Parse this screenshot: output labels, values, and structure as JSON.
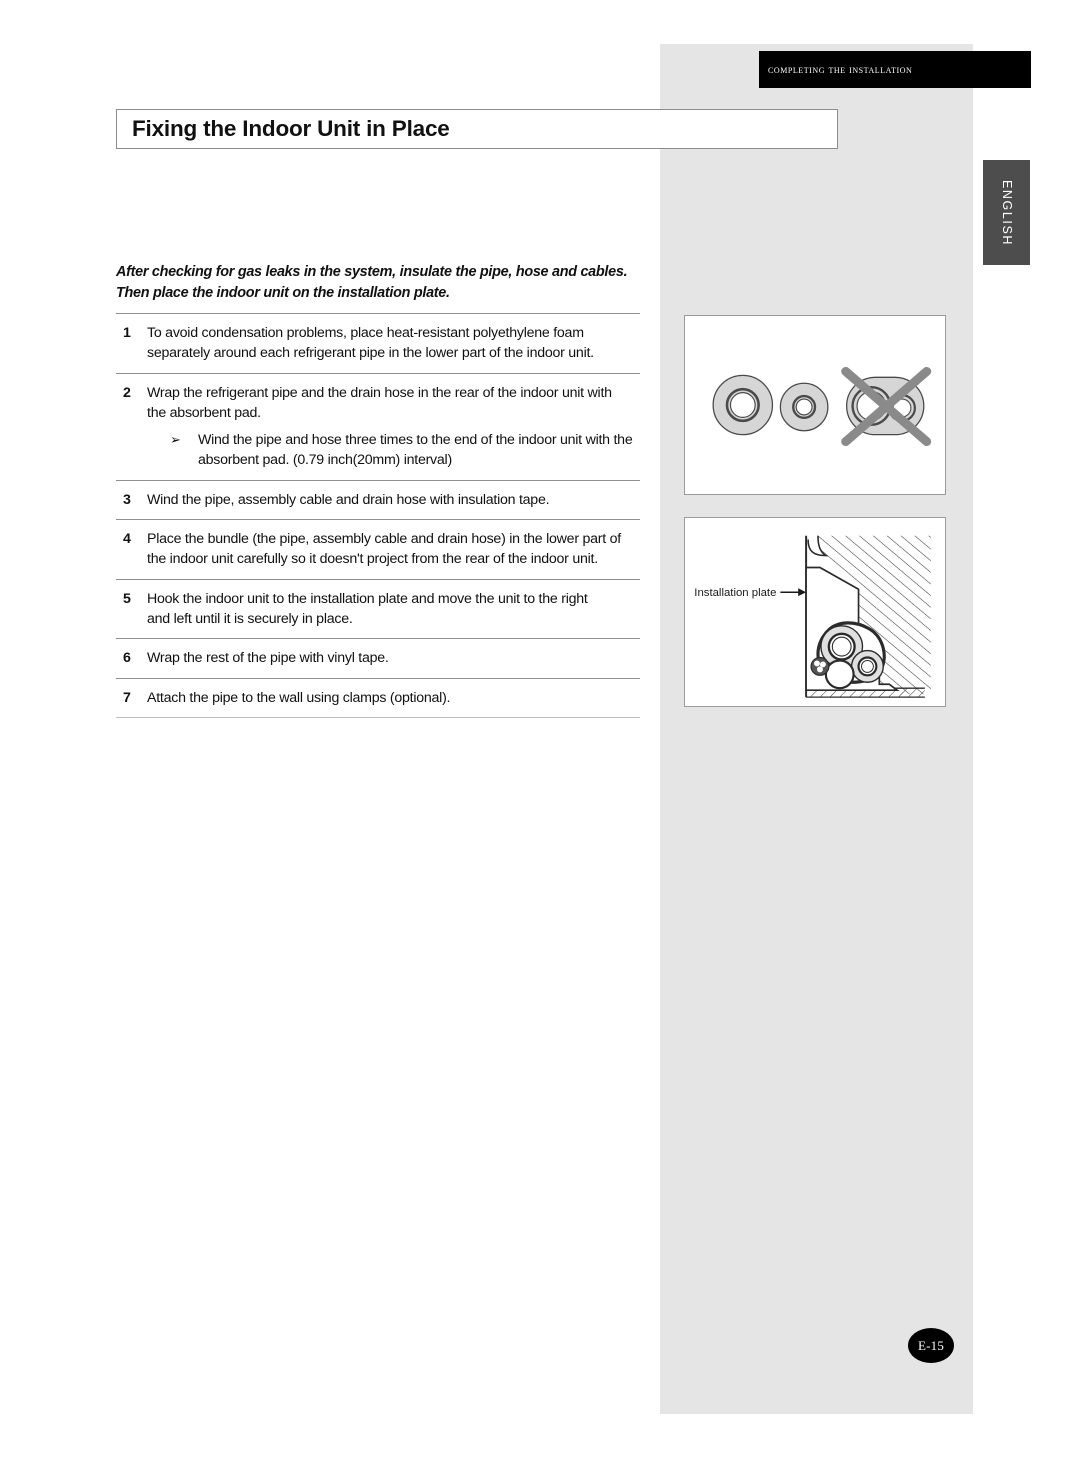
{
  "header": {
    "running_head": "Completing the Installation",
    "language_tab": "ENGLISH"
  },
  "title": "Fixing the Indoor Unit in Place",
  "intro": {
    "line1": "After checking for gas leaks in the system, insulate the pipe, hose and cables.",
    "line2": "Then place the indoor unit on the installation plate."
  },
  "steps": [
    {
      "number": "1",
      "lines": [
        "To avoid condensation problems, place heat-resistant polyethylene foam",
        "separately around each refrigerant pipe in the lower part of the indoor unit."
      ]
    },
    {
      "number": "2",
      "lines": [
        "Wrap the refrigerant pipe and the drain hose in the rear of the indoor unit with",
        "the absorbent pad."
      ],
      "sub": {
        "marker": "➢",
        "lines": [
          "Wind the pipe and hose three times to the end of the indoor unit with the",
          "absorbent pad. (0.79 inch(20mm) interval)"
        ]
      }
    },
    {
      "number": "3",
      "lines": [
        "Wind the pipe, assembly cable and drain hose with insulation tape."
      ]
    },
    {
      "number": "4",
      "lines": [
        "Place the bundle (the pipe, assembly cable and drain hose) in the lower part of",
        "the indoor unit carefully so it doesn't project from the rear of the indoor unit."
      ]
    },
    {
      "number": "5",
      "lines": [
        "Hook the indoor unit to the installation plate and move the unit to the right",
        "and left until it is securely in place."
      ]
    },
    {
      "number": "6",
      "lines": [
        "Wrap the rest of the pipe with vinyl tape."
      ]
    },
    {
      "number": "7",
      "lines": [
        "Attach the pipe to the wall using clamps (optional)."
      ]
    }
  ],
  "figures": {
    "pipes": {
      "caption": "",
      "correct_label": "",
      "incorrect_marker": "x-cross"
    },
    "plate": {
      "label": "Installation plate"
    }
  },
  "page_number": "E-15",
  "colors": {
    "panel_gray": "#e5e5e5",
    "header_black": "#000000",
    "lang_tab_gray": "#4d4d4d",
    "rule_gray": "#8f8f8f",
    "figure_border": "#9a9a9a",
    "fill_gray": "#d6d6d6",
    "cross_gray": "#8a8a8a"
  }
}
